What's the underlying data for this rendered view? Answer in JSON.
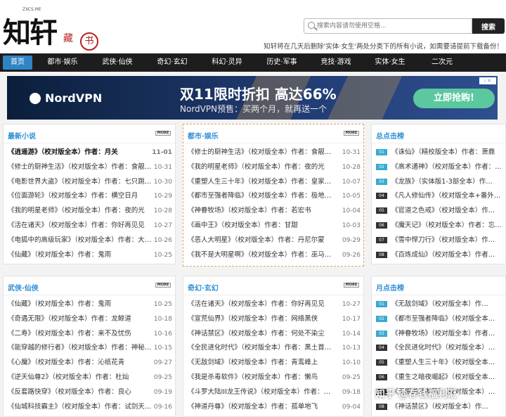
{
  "logo": {
    "main": "知轩",
    "en": "ZXCS.ME",
    "sub1": "藏",
    "sub2": "书"
  },
  "search": {
    "placeholder": "搜索内容请勿使用空格...",
    "button": "搜索"
  },
  "notice": "知轩将在几天后删除'实体·女生'两处分类下的所有小说，如需要请提前下载备份！",
  "nav": [
    "首页",
    "都市·娱乐",
    "武侠·仙侠",
    "奇幻·玄幻",
    "科幻·灵异",
    "历史·军事",
    "竞技·游戏",
    "实体·女生",
    "二次元"
  ],
  "ad": {
    "brand": "NordVPN",
    "headline": "双11限时折扣 高达66%",
    "sub": "NordVPN预售：买两个月，就再送一个",
    "cta": "立即抢购!",
    "badge": "i ✕"
  },
  "more_label": "MORE",
  "panels": {
    "latest": {
      "title": "最新小说",
      "rows": [
        {
          "t": "《逍遥游》（校对版全本）作者：月关",
          "d": "11-01"
        },
        {
          "t": "《修士的厨神生活》（校对版全本）作者：食靓…",
          "d": "10-31"
        },
        {
          "t": "《电影世界大盗》（校对版全本）作者：七只跳…",
          "d": "10-30"
        },
        {
          "t": "《位面游轮》（校对版全本）作者：横空日月",
          "d": "10-29"
        },
        {
          "t": "《我的明星老师》（校对版全本）作者：夜的光",
          "d": "10-28"
        },
        {
          "t": "《活在诸天》（校对版全本）作者：你好再见见",
          "d": "10-27"
        },
        {
          "t": "《电狐中的高级玩家》（校对版全本）作者：大…",
          "d": "10-26"
        },
        {
          "t": "《仙藏》（校对版全本）作者：鬼雨",
          "d": "10-25"
        }
      ]
    },
    "urban": {
      "title": "都市·娱乐",
      "rows": [
        {
          "t": "《修士的厨神生活》（校对版全本）作者：食靓…",
          "d": "10-31"
        },
        {
          "t": "《我的明星老师》（校对版全本）作者：夜的光",
          "d": "10-28"
        },
        {
          "t": "《重塑人生三十年》（校对版全本）作者：皇家…",
          "d": "10-07"
        },
        {
          "t": "《都市至强者降临》（校对版全本）作者：极地…",
          "d": "10-05"
        },
        {
          "t": "《神眷牧场》（校对版全本）作者：若宏书",
          "d": "10-04"
        },
        {
          "t": "《画中王》（校对版全本）作者：甘甜",
          "d": "10-03"
        },
        {
          "t": "《恶人大明星》（校对版全本）作者：丹尼尔蒙",
          "d": "09-29"
        },
        {
          "t": "《我不是大明星啊》（校对版全本）作者：巫马…",
          "d": "09-26"
        }
      ]
    },
    "total_rank": {
      "title": "总点击榜",
      "rows": [
        {
          "n": "01",
          "t": "《诛仙》（精校版全本）作者：萧鼎",
          "hot": true
        },
        {
          "n": "02",
          "t": "《高术通神》（校对版全本）作者：…",
          "hot": true
        },
        {
          "n": "03",
          "t": "《龙族》（实体版1-3部全本）作…",
          "hot": true
        },
        {
          "n": "04",
          "t": "《凡人修仙传》（校对版全本+番外…",
          "hot": false
        },
        {
          "n": "05",
          "t": "《官道之色戒》（校对版全本）作…",
          "hot": false
        },
        {
          "n": "06",
          "t": "《魔天记》（校对版全本）作者：忘…",
          "hot": false
        },
        {
          "n": "07",
          "t": "《雪中悍刀行》（校对版全本）作…",
          "hot": false
        },
        {
          "n": "08",
          "t": "《百炼成仙》（校对版全本）作者…",
          "hot": false
        }
      ]
    },
    "wuxia": {
      "title": "武侠·仙侠",
      "rows": [
        {
          "t": "《仙藏》（校对版全本）作者：鬼雨",
          "d": "10-25"
        },
        {
          "t": "《奇遇无限》（校对版全本）作者：龙鲸道",
          "d": "10-18"
        },
        {
          "t": "《二寿》（校对版全本）作者：来不及忧伤",
          "d": "10-16"
        },
        {
          "t": "《能穿越的修行者》（校对版全本）作者：神秘…",
          "d": "10-15"
        },
        {
          "t": "《心魔》（校对版全本）作者：沁纸花青",
          "d": "09-27"
        },
        {
          "t": "《逆天仙尊2》（校对版全本）作者：杜灿",
          "d": "09-25"
        },
        {
          "t": "《反套路快穿》（校对版全本）作者：良心",
          "d": "09-19"
        },
        {
          "t": "《仙城科技霸主》（校对版全本）作者：试剑天…",
          "d": "09-16"
        }
      ]
    },
    "fantasy": {
      "title": "奇幻·玄幻",
      "rows": [
        {
          "t": "《活在诸天》（校对版全本）作者：你好再见见",
          "d": "10-27"
        },
        {
          "t": "《宣荒仙界》（校对版全本）作者：网络黑侠",
          "d": "10-17"
        },
        {
          "t": "《神话禁区》（校对版全本）作者：何处不染尘",
          "d": "10-14"
        },
        {
          "t": "《全民进化时代》（校对版全本）作者：黑土首…",
          "d": "10-13"
        },
        {
          "t": "《无敌剑域》（校对版全本）作者：青鸾峰上",
          "d": "10-10"
        },
        {
          "t": "《我是杀毒软件》（校对版全本）作者：懒鸟",
          "d": "09-25"
        },
        {
          "t": "《斗罗大陆III龙王传说》（校对版全本）作者：…",
          "d": "09-18"
        },
        {
          "t": "《神道丹尊》（校对版全本）作者：孤单地飞",
          "d": "09-04"
        }
      ]
    },
    "month_rank": {
      "title": "月点击榜",
      "rows": [
        {
          "n": "01",
          "t": "《无敌剑域》（校对版全本）作…",
          "hot": true
        },
        {
          "n": "02",
          "t": "《都市至强者降临》（校对版全本…",
          "hot": true
        },
        {
          "n": "03",
          "t": "《神眷牧场》（校对版全本）作者…",
          "hot": true
        },
        {
          "n": "04",
          "t": "《全民进化时代》（校对版全本）…",
          "hot": false
        },
        {
          "n": "05",
          "t": "《重塑人生三十年》（校对版全本…",
          "hot": false
        },
        {
          "n": "06",
          "t": "《重生之暗夜崛起》（校对版全本…",
          "hot": false
        },
        {
          "n": "07",
          "t": "《无限道武者路》（校对版全本）…",
          "hot": false
        },
        {
          "n": "08",
          "t": "《神话禁区》（校对版全本）作…",
          "hot": false
        }
      ]
    }
  },
  "watermark": "知乎 @存钱福利汇"
}
